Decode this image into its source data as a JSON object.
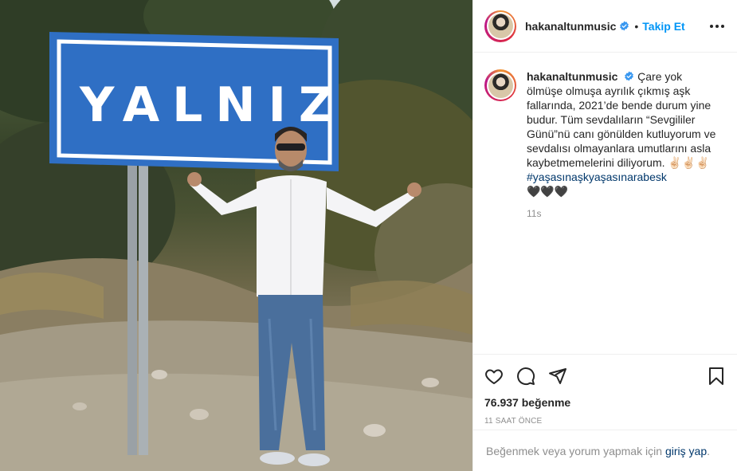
{
  "post": {
    "username": "hakanaltunmusic",
    "follow_label": "Takip Et",
    "separator": "•",
    "caption_parts": [
      "Çare yok ölmüşe olmuşa ayrılık çıkmış aşk fallarında, 2021’de bende durum yine budur. Tüm sevdalıların “Sevgililer Günü”nü canı gönülden kutluyorum ve sevdalısı olmayanlara umutlarını asla kaybetmemelerini diliyorum. ✌🏻✌🏻✌🏻",
      "#yaşasınaşkyaşasınarabesk",
      "🖤🖤🖤"
    ],
    "caption_time": "11s",
    "likes": "76.937 beğenme",
    "posted_ago": "11 SAAT ÖNCE",
    "login_prompt": "Beğenmek veya yorum yapmak için",
    "login_link": "giriş yap",
    "login_period": "."
  },
  "photo": {
    "sign_text": "YALNIZ",
    "sign_color": "#2f6fc4"
  },
  "colors": {
    "accent": "#0095f6",
    "hashtag": "#00376b",
    "muted": "#8e8e8e",
    "verified": "#3897f0"
  },
  "icons": [
    "verified-badge-icon",
    "more-options-icon",
    "heart-icon",
    "comment-icon",
    "share-icon",
    "bookmark-icon"
  ]
}
